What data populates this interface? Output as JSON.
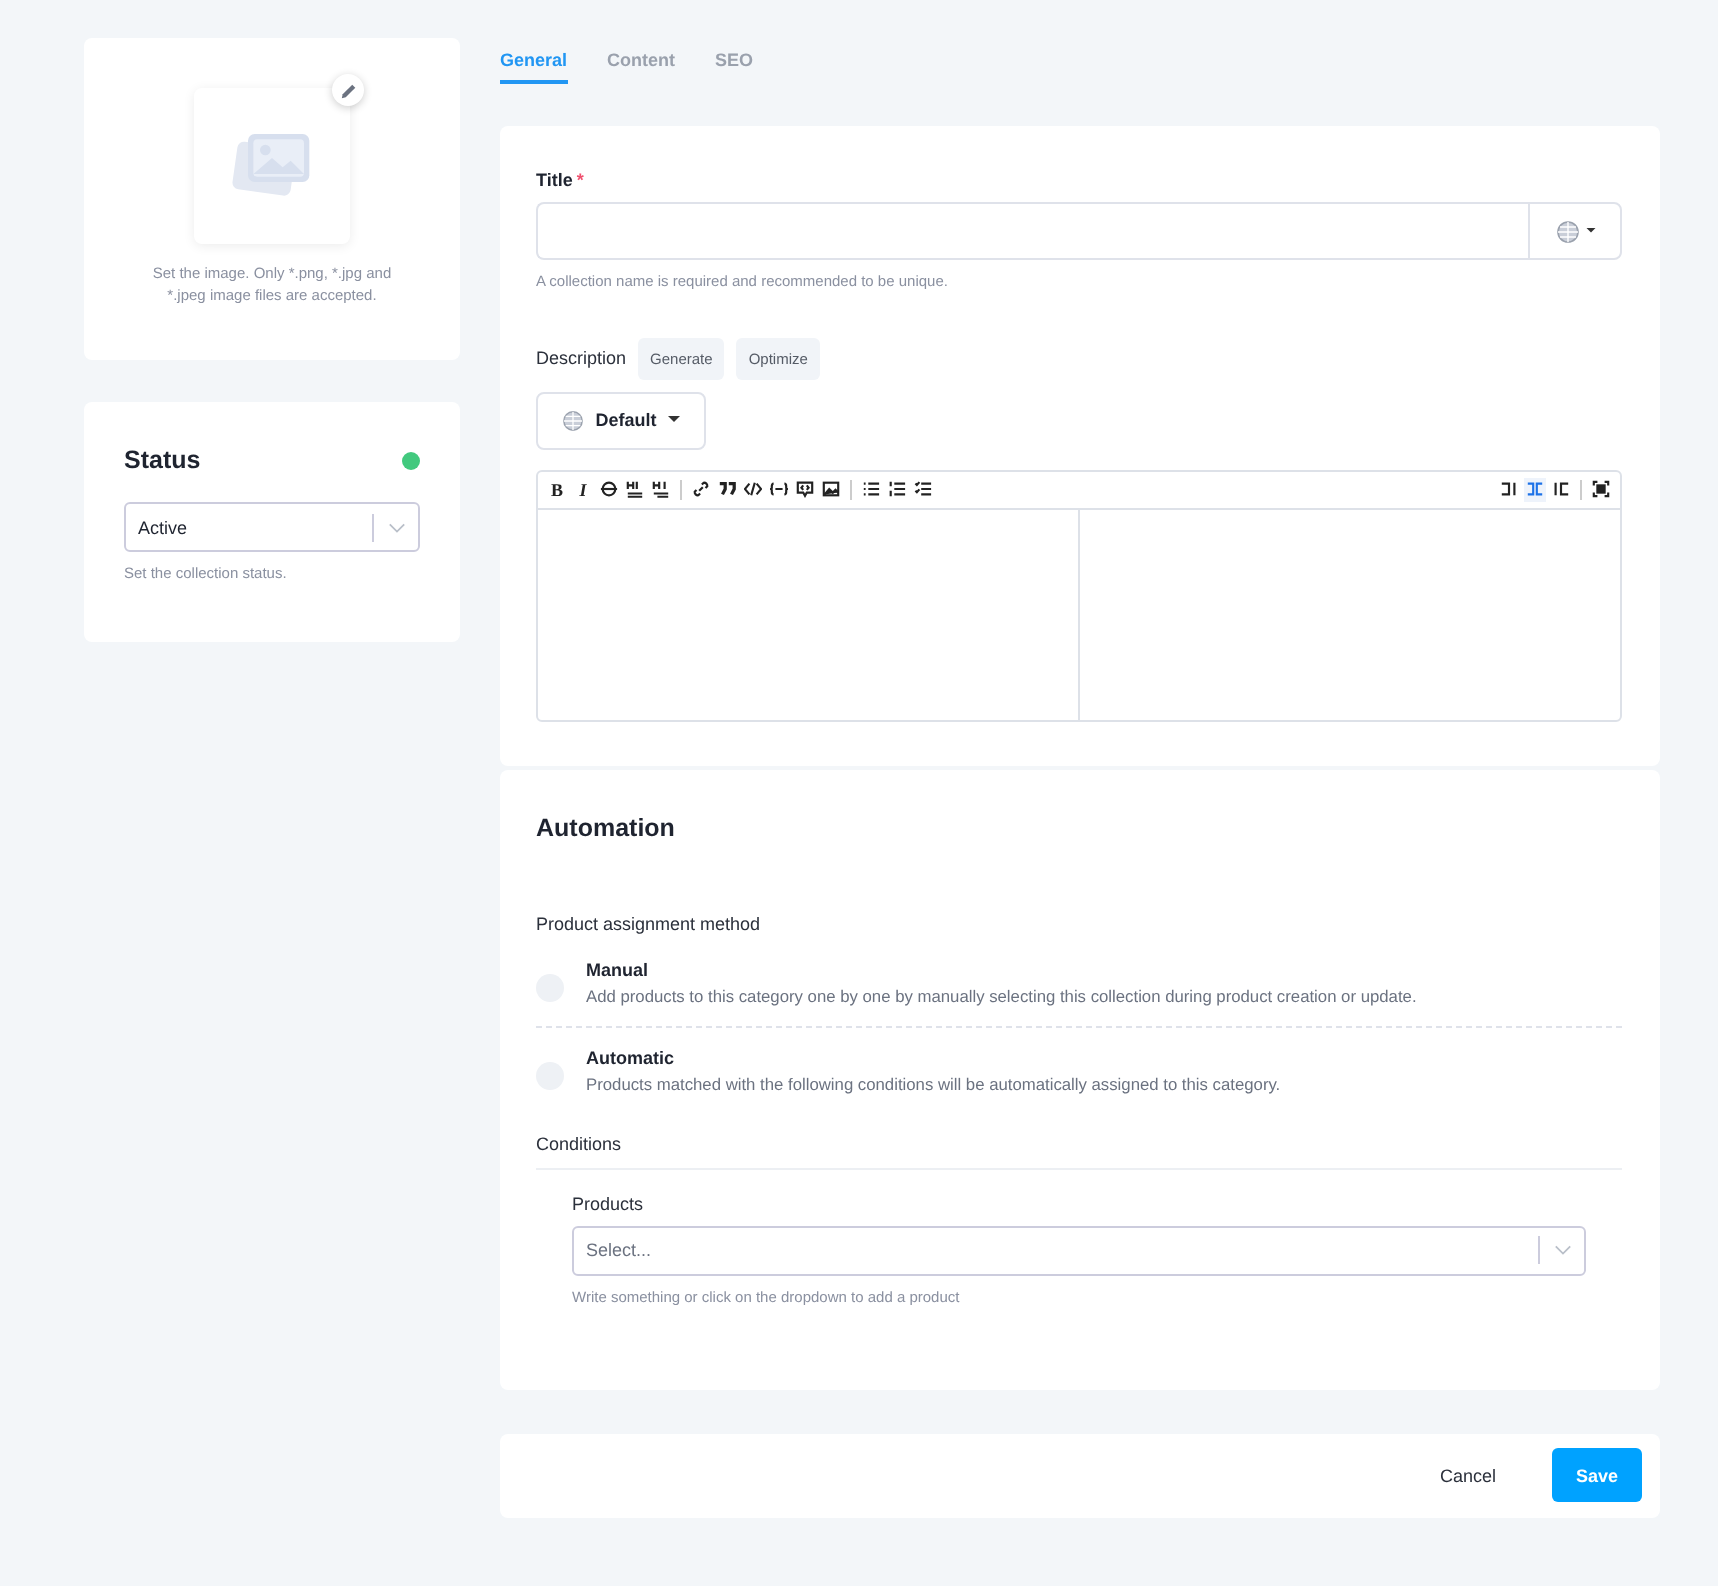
{
  "image_card": {
    "hint": "Set the image. Only *.png, *.jpg and *.jpeg image files are accepted."
  },
  "status_card": {
    "title": "Status",
    "active": true,
    "select_value": "Active",
    "hint": "Set the collection status."
  },
  "tabs": [
    {
      "label": "General",
      "selected": true
    },
    {
      "label": "Content",
      "selected": false
    },
    {
      "label": "SEO",
      "selected": false
    }
  ],
  "title_field": {
    "label": "Title",
    "required_mark": "*",
    "hint": "A collection name is required and recommended to be unique."
  },
  "description": {
    "label": "Description",
    "buttons": [
      "Generate",
      "Optimize"
    ],
    "language": "Default"
  },
  "toolbar_left": [
    {
      "kind": "bold",
      "text": "B"
    },
    {
      "kind": "italic",
      "text": "I"
    },
    {
      "kind": "strike"
    },
    {
      "kind": "heading-up"
    },
    {
      "kind": "heading-down"
    },
    {
      "kind": "sep"
    },
    {
      "kind": "link"
    },
    {
      "kind": "quote"
    },
    {
      "kind": "code"
    },
    {
      "kind": "code-block"
    },
    {
      "kind": "comment"
    },
    {
      "kind": "image"
    },
    {
      "kind": "sep"
    },
    {
      "kind": "ul"
    },
    {
      "kind": "ol"
    },
    {
      "kind": "checklist"
    }
  ],
  "toolbar_right": [
    {
      "kind": "edit-mode",
      "selected": false
    },
    {
      "kind": "split-mode",
      "selected": true
    },
    {
      "kind": "preview-mode",
      "selected": false
    },
    {
      "kind": "sep"
    },
    {
      "kind": "fullscreen",
      "selected": false
    }
  ],
  "automation": {
    "title": "Automation",
    "method_label": "Product assignment method",
    "options": [
      {
        "label": "Manual",
        "description": "Add products to this category one by one by manually selecting this collection during product creation or update.",
        "selected": false
      },
      {
        "label": "Automatic",
        "description": "Products matched with the following conditions will be automatically assigned to this category.",
        "selected": false
      }
    ],
    "conditions_label": "Conditions",
    "products_label": "Products",
    "products_placeholder": "Select...",
    "products_hint": "Write something or click on the dropdown to add a product"
  },
  "footer": {
    "cancel": "Cancel",
    "save": "Save"
  }
}
